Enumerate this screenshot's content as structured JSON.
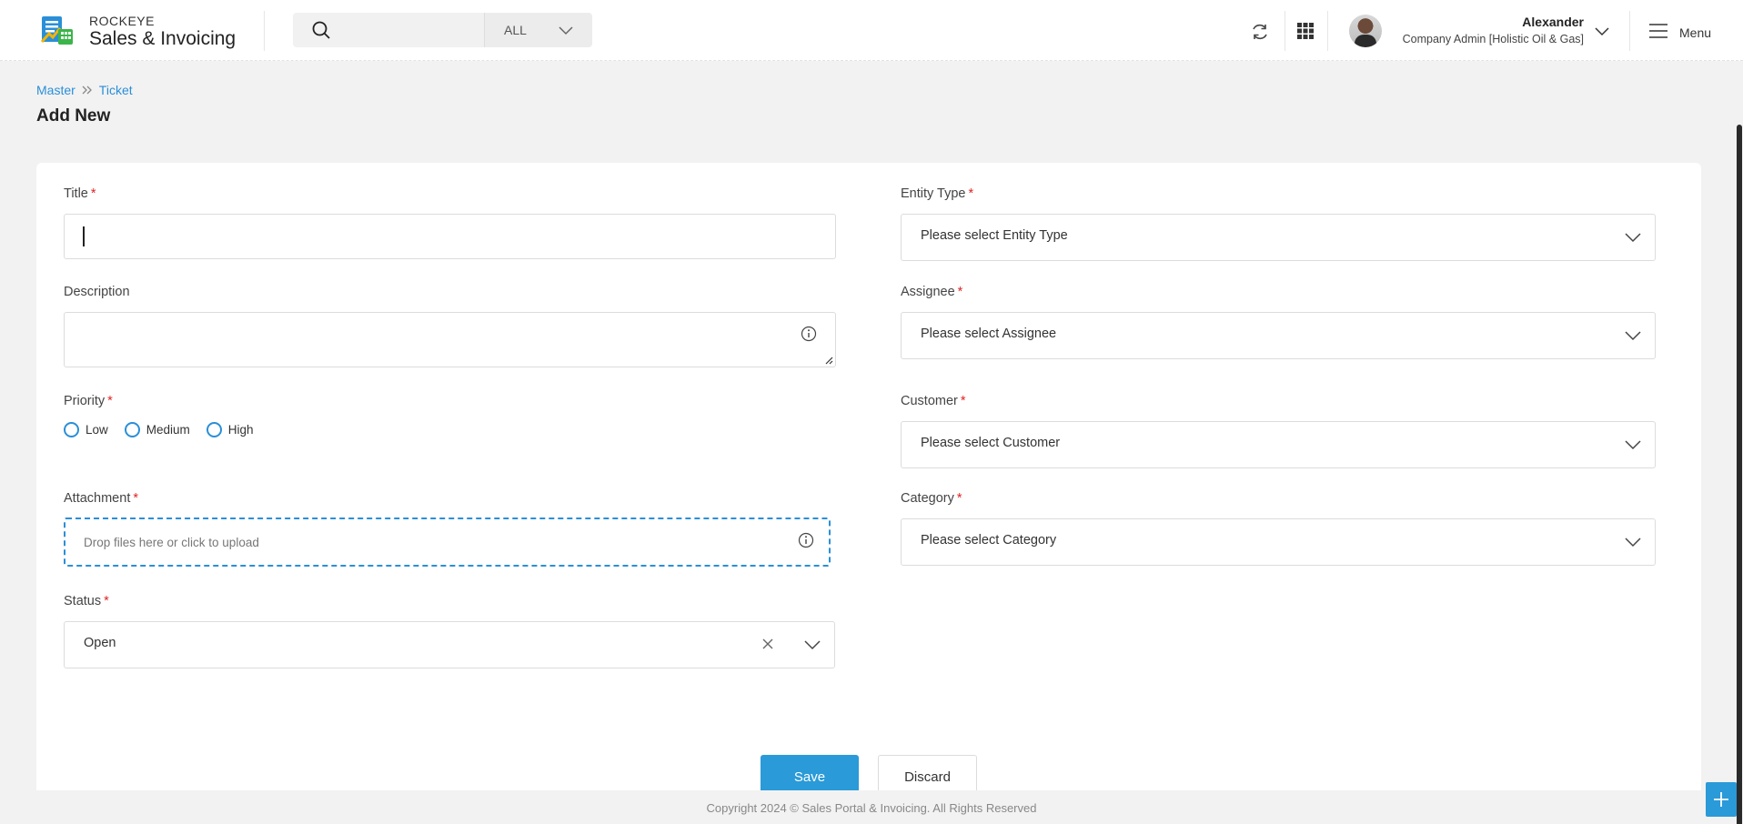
{
  "brand": {
    "small": "ROCKEYE",
    "big": "Sales & Invoicing"
  },
  "search": {
    "placeholder": "",
    "scope": "ALL"
  },
  "user": {
    "name": "Alexander",
    "role": "Company Admin [Holistic Oil & Gas]"
  },
  "menu_label": "Menu",
  "breadcrumb": [
    "Master",
    "Ticket"
  ],
  "page_title": "Add New",
  "form": {
    "title": {
      "label": "Title",
      "value": ""
    },
    "description": {
      "label": "Description",
      "value": ""
    },
    "priority": {
      "label": "Priority",
      "options": [
        "Low",
        "Medium",
        "High"
      ]
    },
    "attachment": {
      "label": "Attachment",
      "placeholder": "Drop files here or click to upload"
    },
    "status": {
      "label": "Status",
      "value": "Open"
    },
    "entity_type": {
      "label": "Entity Type",
      "placeholder": "Please select Entity Type"
    },
    "assignee": {
      "label": "Assignee",
      "placeholder": "Please select Assignee"
    },
    "customer": {
      "label": "Customer",
      "placeholder": "Please select Customer"
    },
    "category": {
      "label": "Category",
      "placeholder": "Please select Category"
    },
    "required_mark": "*"
  },
  "buttons": {
    "save": "Save",
    "discard": "Discard"
  },
  "footer": "Copyright 2024 © Sales Portal & Invoicing. All Rights Reserved",
  "colors": {
    "accent": "#2a9ad8",
    "required": "#e02424"
  }
}
